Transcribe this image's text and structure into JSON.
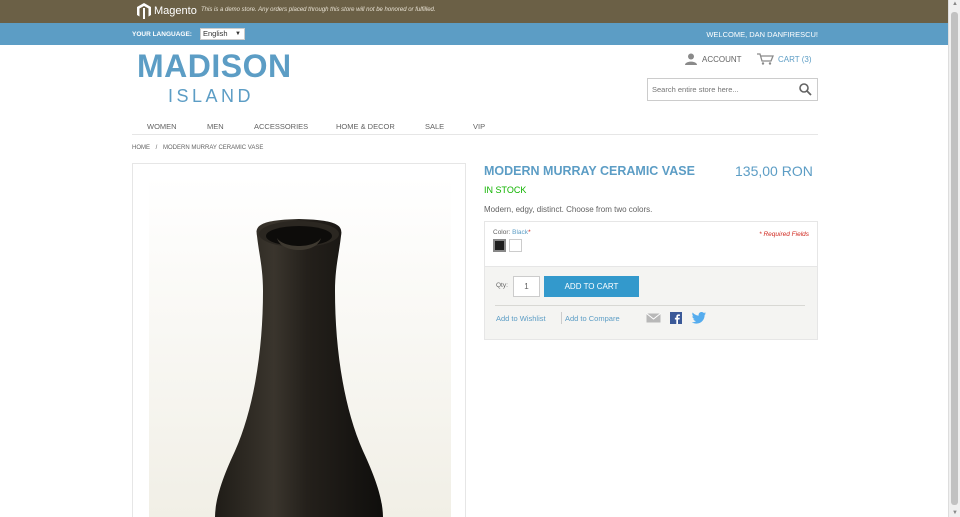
{
  "demo_bar": {
    "logo_text": "Magento",
    "notice": "This is a demo store. Any orders placed through this store will not be honored or fulfilled."
  },
  "lang_bar": {
    "label": "YOUR LANGUAGE:",
    "selected": "English",
    "welcome": "WELCOME, DAN DANFIRESCU!"
  },
  "header": {
    "logo_main": "MADISON",
    "logo_sub": "ISLAND",
    "account": "ACCOUNT",
    "cart": "CART (3)",
    "search_placeholder": "Search entire store here..."
  },
  "nav": {
    "items": [
      "WOMEN",
      "MEN",
      "ACCESSORIES",
      "HOME & DECOR",
      "SALE",
      "VIP"
    ]
  },
  "breadcrumb": {
    "home": "HOME",
    "separator": "/",
    "current": "MODERN MURRAY CERAMIC VASE"
  },
  "product": {
    "name": "MODERN MURRAY CERAMIC VASE",
    "price": "135,00 RON",
    "stock": "IN STOCK",
    "short_description": "Modern, edgy, distinct. Choose from two colors.",
    "color_label": "Color:",
    "color_value": "Black",
    "required_mark": "*",
    "required_fields": "* Required Fields",
    "swatches": [
      {
        "name": "black",
        "color": "#1e1e1e"
      },
      {
        "name": "white",
        "color": "#ffffff"
      }
    ],
    "qty_label": "Qty:",
    "qty_value": "1",
    "add_to_cart": "ADD TO CART",
    "add_to_wishlist": "Add to Wishlist",
    "add_to_compare": "Add to Compare"
  },
  "colors": {
    "accent": "#5c9dc5",
    "button": "#3399cc",
    "demo_bar": "#6b6046",
    "in_stock": "#11b400",
    "required": "#d0281f"
  }
}
